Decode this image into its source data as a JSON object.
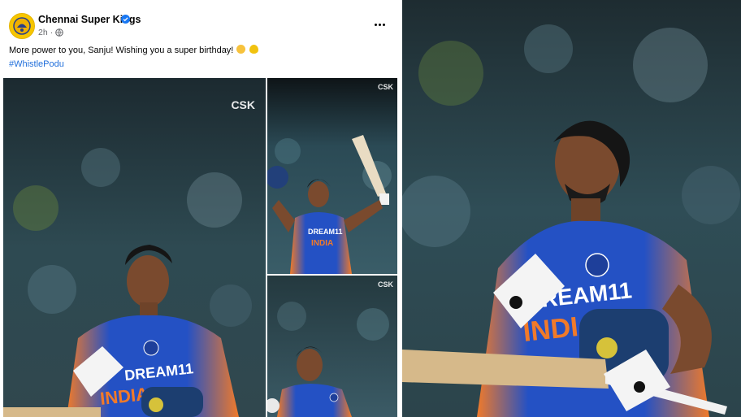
{
  "post": {
    "page_name": "Chennai Super Kings",
    "time": "2h",
    "dot": "·",
    "caption": "More power to you, Sanju! Wishing you a super birthday!",
    "hashtag": "#WhistlePodu"
  },
  "icons": {
    "verified": "verified-badge-icon",
    "privacy": "globe-icon",
    "more": "more-options-icon",
    "emoji_1": "smiling-face-with-sunglasses-emoji",
    "emoji_2": "yellow-heart-emoji"
  },
  "photos": {
    "jersey_sponsor": "DREAM11",
    "jersey_country": "INDIA",
    "watermark": "CSK"
  },
  "colors": {
    "link": "#216fdb",
    "verified": "#1877f2",
    "jersey_blue": "#2451c4",
    "jersey_orange": "#f07a2a"
  }
}
